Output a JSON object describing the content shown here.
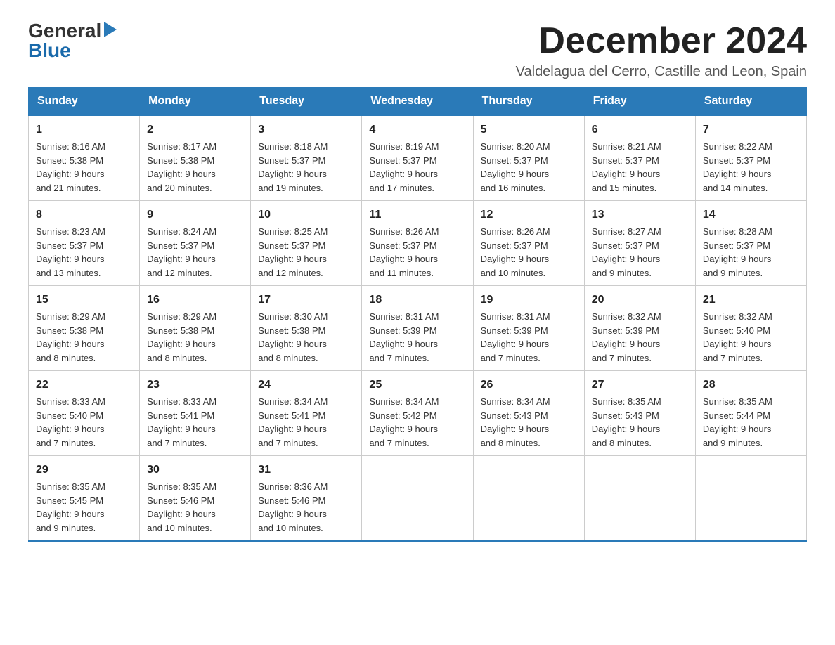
{
  "logo": {
    "general": "General",
    "blue": "Blue"
  },
  "title": "December 2024",
  "subtitle": "Valdelagua del Cerro, Castille and Leon, Spain",
  "days_of_week": [
    "Sunday",
    "Monday",
    "Tuesday",
    "Wednesday",
    "Thursday",
    "Friday",
    "Saturday"
  ],
  "weeks": [
    [
      {
        "day": "1",
        "sunrise": "8:16 AM",
        "sunset": "5:38 PM",
        "daylight": "9 hours and 21 minutes."
      },
      {
        "day": "2",
        "sunrise": "8:17 AM",
        "sunset": "5:38 PM",
        "daylight": "9 hours and 20 minutes."
      },
      {
        "day": "3",
        "sunrise": "8:18 AM",
        "sunset": "5:37 PM",
        "daylight": "9 hours and 19 minutes."
      },
      {
        "day": "4",
        "sunrise": "8:19 AM",
        "sunset": "5:37 PM",
        "daylight": "9 hours and 17 minutes."
      },
      {
        "day": "5",
        "sunrise": "8:20 AM",
        "sunset": "5:37 PM",
        "daylight": "9 hours and 16 minutes."
      },
      {
        "day": "6",
        "sunrise": "8:21 AM",
        "sunset": "5:37 PM",
        "daylight": "9 hours and 15 minutes."
      },
      {
        "day": "7",
        "sunrise": "8:22 AM",
        "sunset": "5:37 PM",
        "daylight": "9 hours and 14 minutes."
      }
    ],
    [
      {
        "day": "8",
        "sunrise": "8:23 AM",
        "sunset": "5:37 PM",
        "daylight": "9 hours and 13 minutes."
      },
      {
        "day": "9",
        "sunrise": "8:24 AM",
        "sunset": "5:37 PM",
        "daylight": "9 hours and 12 minutes."
      },
      {
        "day": "10",
        "sunrise": "8:25 AM",
        "sunset": "5:37 PM",
        "daylight": "9 hours and 12 minutes."
      },
      {
        "day": "11",
        "sunrise": "8:26 AM",
        "sunset": "5:37 PM",
        "daylight": "9 hours and 11 minutes."
      },
      {
        "day": "12",
        "sunrise": "8:26 AM",
        "sunset": "5:37 PM",
        "daylight": "9 hours and 10 minutes."
      },
      {
        "day": "13",
        "sunrise": "8:27 AM",
        "sunset": "5:37 PM",
        "daylight": "9 hours and 9 minutes."
      },
      {
        "day": "14",
        "sunrise": "8:28 AM",
        "sunset": "5:37 PM",
        "daylight": "9 hours and 9 minutes."
      }
    ],
    [
      {
        "day": "15",
        "sunrise": "8:29 AM",
        "sunset": "5:38 PM",
        "daylight": "9 hours and 8 minutes."
      },
      {
        "day": "16",
        "sunrise": "8:29 AM",
        "sunset": "5:38 PM",
        "daylight": "9 hours and 8 minutes."
      },
      {
        "day": "17",
        "sunrise": "8:30 AM",
        "sunset": "5:38 PM",
        "daylight": "9 hours and 8 minutes."
      },
      {
        "day": "18",
        "sunrise": "8:31 AM",
        "sunset": "5:39 PM",
        "daylight": "9 hours and 7 minutes."
      },
      {
        "day": "19",
        "sunrise": "8:31 AM",
        "sunset": "5:39 PM",
        "daylight": "9 hours and 7 minutes."
      },
      {
        "day": "20",
        "sunrise": "8:32 AM",
        "sunset": "5:39 PM",
        "daylight": "9 hours and 7 minutes."
      },
      {
        "day": "21",
        "sunrise": "8:32 AM",
        "sunset": "5:40 PM",
        "daylight": "9 hours and 7 minutes."
      }
    ],
    [
      {
        "day": "22",
        "sunrise": "8:33 AM",
        "sunset": "5:40 PM",
        "daylight": "9 hours and 7 minutes."
      },
      {
        "day": "23",
        "sunrise": "8:33 AM",
        "sunset": "5:41 PM",
        "daylight": "9 hours and 7 minutes."
      },
      {
        "day": "24",
        "sunrise": "8:34 AM",
        "sunset": "5:41 PM",
        "daylight": "9 hours and 7 minutes."
      },
      {
        "day": "25",
        "sunrise": "8:34 AM",
        "sunset": "5:42 PM",
        "daylight": "9 hours and 7 minutes."
      },
      {
        "day": "26",
        "sunrise": "8:34 AM",
        "sunset": "5:43 PM",
        "daylight": "9 hours and 8 minutes."
      },
      {
        "day": "27",
        "sunrise": "8:35 AM",
        "sunset": "5:43 PM",
        "daylight": "9 hours and 8 minutes."
      },
      {
        "day": "28",
        "sunrise": "8:35 AM",
        "sunset": "5:44 PM",
        "daylight": "9 hours and 9 minutes."
      }
    ],
    [
      {
        "day": "29",
        "sunrise": "8:35 AM",
        "sunset": "5:45 PM",
        "daylight": "9 hours and 9 minutes."
      },
      {
        "day": "30",
        "sunrise": "8:35 AM",
        "sunset": "5:46 PM",
        "daylight": "9 hours and 10 minutes."
      },
      {
        "day": "31",
        "sunrise": "8:36 AM",
        "sunset": "5:46 PM",
        "daylight": "9 hours and 10 minutes."
      },
      null,
      null,
      null,
      null
    ]
  ]
}
